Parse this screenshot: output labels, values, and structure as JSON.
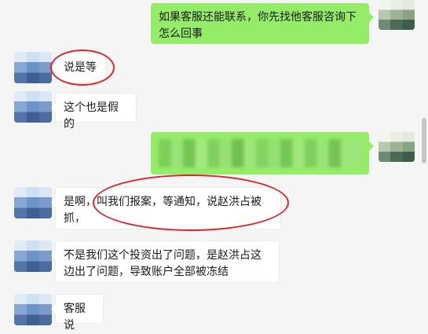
{
  "messages": [
    {
      "side": "out",
      "text": "如果客服还能联系，你先找他客服咨询下怎么回事"
    },
    {
      "side": "in",
      "text": "说是等"
    },
    {
      "side": "in",
      "text": "这个也是假的"
    },
    {
      "side": "out",
      "text": ""
    },
    {
      "side": "in",
      "text": "是啊，叫我们报案，等通知，说赵洪占被抓，"
    },
    {
      "side": "in",
      "text": "不是我们这个投资出了问题，是赵洪占这边出了问题，导致账户全部被冻结"
    },
    {
      "side": "in",
      "text": "客服说"
    }
  ],
  "colors": {
    "background": "#f5f5f5",
    "outgoing_bubble": "#95ec69",
    "incoming_bubble": "#ffffff",
    "annotation": "#d9262c"
  }
}
